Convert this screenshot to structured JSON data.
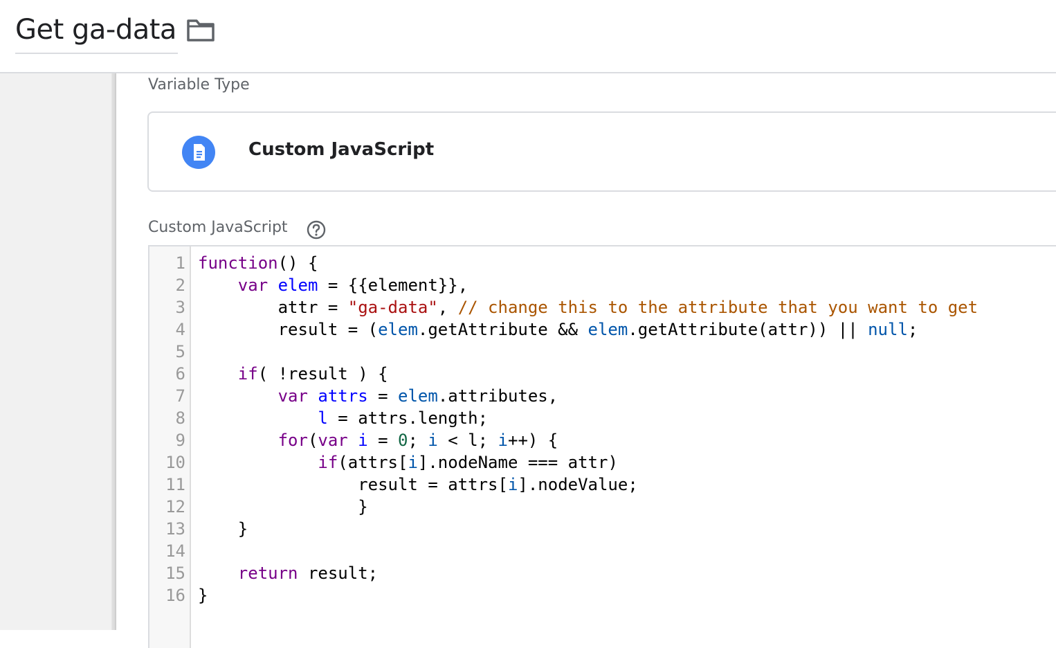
{
  "header": {
    "title": "Get ga-data",
    "folder_icon": "folder-icon"
  },
  "variable_type": {
    "label": "Variable Type",
    "name": "Custom JavaScript",
    "icon": "document-icon",
    "icon_color": "#4285f4"
  },
  "code_section": {
    "label": "Custom JavaScript",
    "help_icon": "help-circle-icon",
    "line_numbers": [
      "1",
      "2",
      "3",
      "4",
      "5",
      "6",
      "7",
      "8",
      "9",
      "10",
      "11",
      "12",
      "13",
      "14",
      "15",
      "16"
    ],
    "lines": [
      [
        {
          "t": "function",
          "c": "kw"
        },
        {
          "t": "() {",
          "c": ""
        }
      ],
      [
        {
          "t": "    ",
          "c": ""
        },
        {
          "t": "var",
          "c": "kw"
        },
        {
          "t": " ",
          "c": ""
        },
        {
          "t": "elem",
          "c": "def"
        },
        {
          "t": " = {{element}},",
          "c": ""
        }
      ],
      [
        {
          "t": "        attr = ",
          "c": ""
        },
        {
          "t": "\"ga-data\"",
          "c": "str"
        },
        {
          "t": ", ",
          "c": ""
        },
        {
          "t": "// change this to the attribute that you want to get",
          "c": "com"
        }
      ],
      [
        {
          "t": "        result = (",
          "c": ""
        },
        {
          "t": "elem",
          "c": "var2"
        },
        {
          "t": ".getAttribute && ",
          "c": ""
        },
        {
          "t": "elem",
          "c": "var2"
        },
        {
          "t": ".getAttribute(attr)) || ",
          "c": ""
        },
        {
          "t": "null",
          "c": "var2"
        },
        {
          "t": ";",
          "c": ""
        }
      ],
      [
        {
          "t": "",
          "c": ""
        }
      ],
      [
        {
          "t": "    ",
          "c": ""
        },
        {
          "t": "if",
          "c": "kw"
        },
        {
          "t": "( !result ) {",
          "c": ""
        }
      ],
      [
        {
          "t": "        ",
          "c": ""
        },
        {
          "t": "var",
          "c": "kw"
        },
        {
          "t": " ",
          "c": ""
        },
        {
          "t": "attrs",
          "c": "def"
        },
        {
          "t": " = ",
          "c": ""
        },
        {
          "t": "elem",
          "c": "var2"
        },
        {
          "t": ".attributes,",
          "c": ""
        }
      ],
      [
        {
          "t": "            ",
          "c": ""
        },
        {
          "t": "l",
          "c": "def"
        },
        {
          "t": " = attrs.length;",
          "c": ""
        }
      ],
      [
        {
          "t": "        ",
          "c": ""
        },
        {
          "t": "for",
          "c": "kw"
        },
        {
          "t": "(",
          "c": ""
        },
        {
          "t": "var",
          "c": "kw"
        },
        {
          "t": " ",
          "c": ""
        },
        {
          "t": "i",
          "c": "def"
        },
        {
          "t": " = ",
          "c": ""
        },
        {
          "t": "0",
          "c": "num"
        },
        {
          "t": "; ",
          "c": ""
        },
        {
          "t": "i",
          "c": "var2"
        },
        {
          "t": " < l; ",
          "c": ""
        },
        {
          "t": "i",
          "c": "var2"
        },
        {
          "t": "++) {",
          "c": ""
        }
      ],
      [
        {
          "t": "            ",
          "c": ""
        },
        {
          "t": "if",
          "c": "kw"
        },
        {
          "t": "(attrs[",
          "c": ""
        },
        {
          "t": "i",
          "c": "var2"
        },
        {
          "t": "].nodeName === attr)",
          "c": ""
        }
      ],
      [
        {
          "t": "                result = attrs[",
          "c": ""
        },
        {
          "t": "i",
          "c": "var2"
        },
        {
          "t": "].nodeValue;",
          "c": ""
        }
      ],
      [
        {
          "t": "                }",
          "c": ""
        }
      ],
      [
        {
          "t": "    }",
          "c": ""
        }
      ],
      [
        {
          "t": "",
          "c": ""
        }
      ],
      [
        {
          "t": "    ",
          "c": ""
        },
        {
          "t": "return",
          "c": "kw"
        },
        {
          "t": " result;",
          "c": ""
        }
      ],
      [
        {
          "t": "}",
          "c": ""
        }
      ]
    ]
  }
}
